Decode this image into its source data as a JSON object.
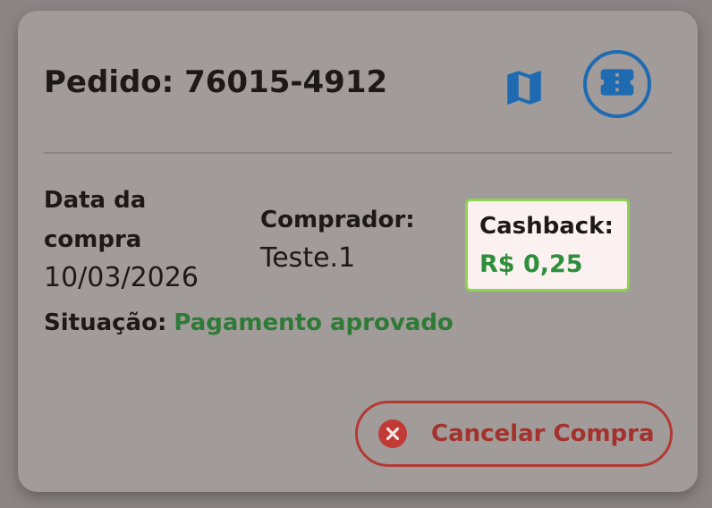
{
  "order": {
    "title": "Pedido: 76015-4912",
    "map_icon": "map-icon",
    "ticket_icon": "ticket-icon"
  },
  "details": {
    "purchase_date_label": "Data da compra",
    "purchase_date": "10/03/2026",
    "buyer_label": "Comprador:",
    "buyer": "Teste.1",
    "cashback_label": "Cashback:",
    "cashback": "R$ 0,25"
  },
  "status": {
    "label": "Situação:",
    "value": "Pagamento aprovado"
  },
  "actions": {
    "cancel_label": "Cancelar Compra",
    "cancel_icon": "close-circle-icon"
  },
  "colors": {
    "accent_blue": "#1f6bb2",
    "success_green": "#2f7a36",
    "danger_red": "#b33a33",
    "highlight_border": "#8fd451"
  }
}
